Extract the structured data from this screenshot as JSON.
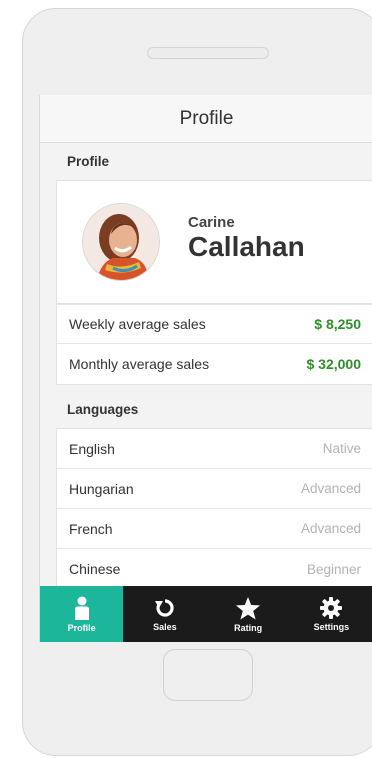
{
  "navbar": {
    "title": "Profile"
  },
  "profile_section": {
    "title": "Profile"
  },
  "profile": {
    "first_name": "Carine",
    "last_name": "Callahan"
  },
  "stats": [
    {
      "label": "Weekly average sales",
      "value": "$ 8,250"
    },
    {
      "label": "Monthly average sales",
      "value": "$ 32,000"
    }
  ],
  "languages_section": {
    "title": "Languages"
  },
  "languages": [
    {
      "name": "English",
      "level": "Native"
    },
    {
      "name": "Hungarian",
      "level": "Advanced"
    },
    {
      "name": "French",
      "level": "Advanced"
    },
    {
      "name": "Chinese",
      "level": "Beginner"
    }
  ],
  "tabs": [
    {
      "label": "Profile",
      "icon": "person-icon",
      "active": true
    },
    {
      "label": "Sales",
      "icon": "refresh-icon"
    },
    {
      "label": "Rating",
      "icon": "star-icon"
    },
    {
      "label": "Settings",
      "icon": "gear-icon"
    }
  ],
  "colors": {
    "accent": "#1cb79b",
    "money": "#2f8f28",
    "tabbar": "#1b1b1b"
  }
}
